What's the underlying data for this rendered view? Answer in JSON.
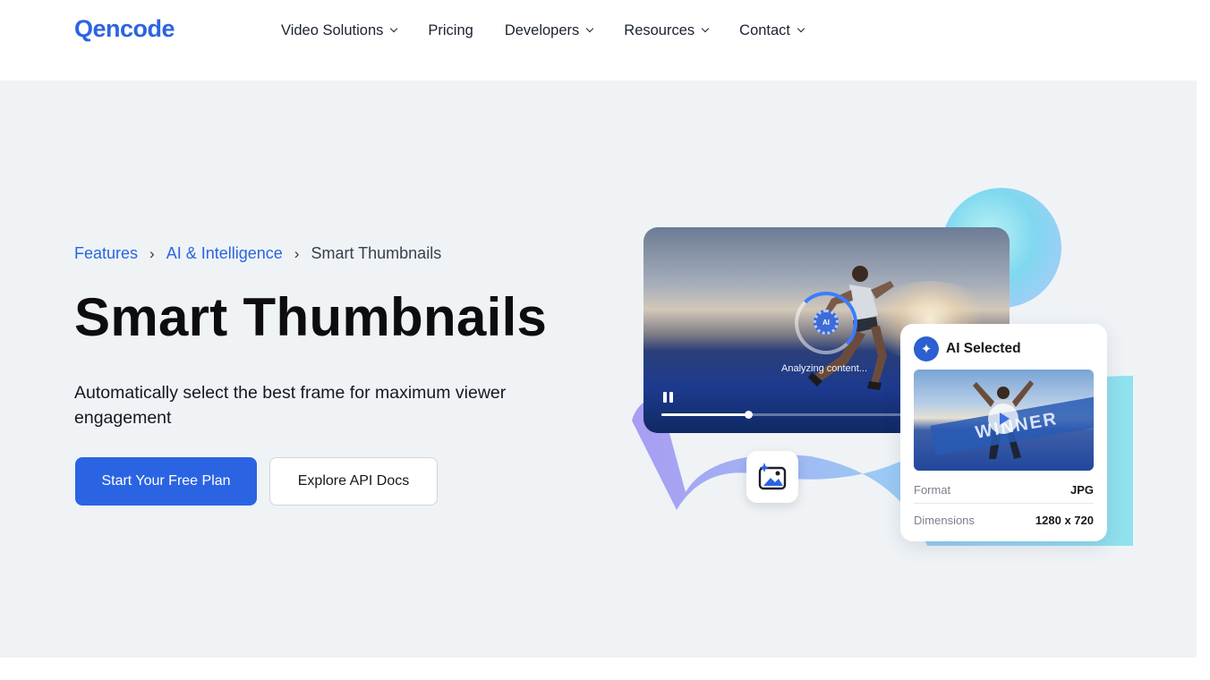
{
  "header": {
    "logo": "Qencode",
    "nav": [
      {
        "label": "Video Solutions",
        "has_dropdown": true
      },
      {
        "label": "Pricing",
        "has_dropdown": false
      },
      {
        "label": "Developers",
        "has_dropdown": true
      },
      {
        "label": "Resources",
        "has_dropdown": true
      },
      {
        "label": "Contact",
        "has_dropdown": true
      }
    ]
  },
  "breadcrumb": {
    "items": [
      "Features",
      "AI & Intelligence"
    ],
    "current": "Smart Thumbnails",
    "separator": "›"
  },
  "hero": {
    "title": "Smart Thumbnails",
    "subtitle": "Automatically select the best frame for maximum viewer engagement",
    "primary_button": "Start Your Free Plan",
    "secondary_button": "Explore API Docs"
  },
  "video": {
    "ai_label": "AI",
    "status_text": "Analyzing content...",
    "progress": 0.36
  },
  "ai_card": {
    "title": "AI Selected",
    "thumbnail_text": "WINNER",
    "meta": [
      {
        "key": "Format",
        "value": "JPG"
      },
      {
        "key": "Dimensions",
        "value": "1280 x 720"
      }
    ]
  },
  "colors": {
    "brand": "#2b64e3",
    "hero_bg": "#eff3f6"
  },
  "icons": [
    "chevron-down-icon",
    "pause-icon",
    "ai-gear-icon",
    "sparkle-icon",
    "image-ai-icon",
    "play-icon"
  ]
}
